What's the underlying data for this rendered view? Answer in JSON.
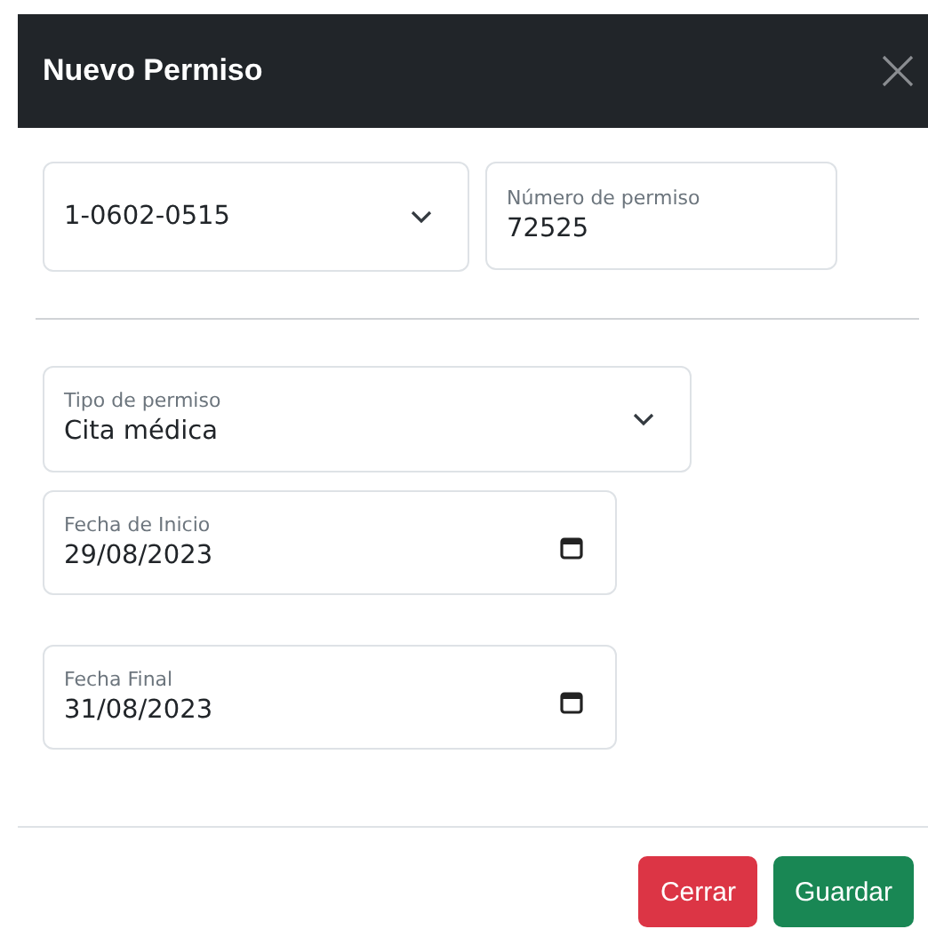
{
  "dialog": {
    "title": "Nuevo Permiso"
  },
  "top_fields": [
    {
      "kind": "select",
      "value": "1-0602-0515"
    },
    {
      "kind": "text",
      "label": "Número de permiso",
      "value": "72525"
    }
  ],
  "fields": [
    {
      "kind": "select",
      "label": "Tipo de permiso",
      "value": "Cita médica"
    },
    {
      "kind": "date",
      "label": "Fecha de Inicio",
      "value": "29/08/2023"
    },
    {
      "kind": "date",
      "label": "Fecha Final",
      "value": "31/08/2023"
    }
  ],
  "buttons": [
    {
      "label": "Cerrar",
      "kind": "danger"
    },
    {
      "label": "Guardar",
      "kind": "success"
    }
  ]
}
